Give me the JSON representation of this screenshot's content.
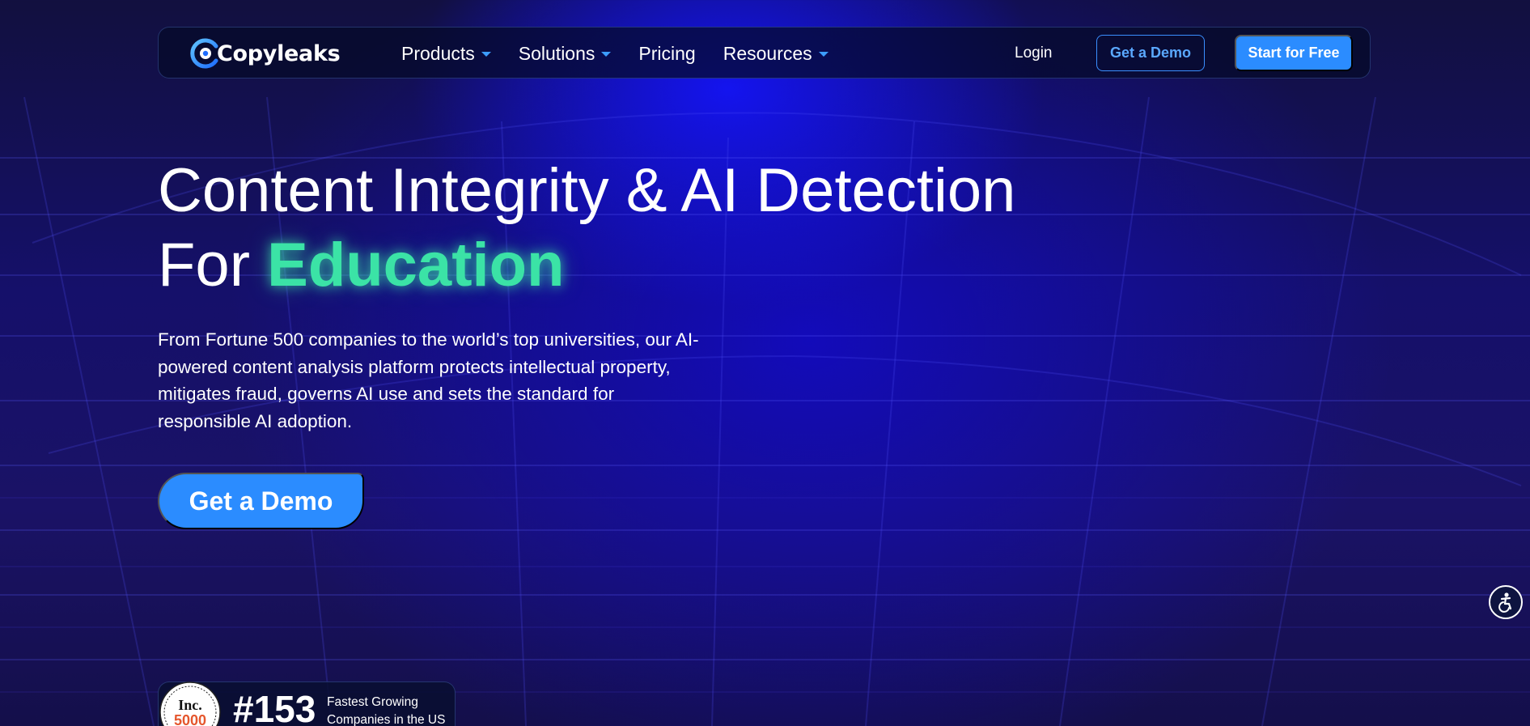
{
  "brand": {
    "name": "Copyleaks",
    "logo_icon": "copyleaks-logo-icon",
    "primary_color": "#2b8cff",
    "accent_color": "#3be3a6"
  },
  "nav": {
    "items": [
      {
        "label": "Products",
        "has_dropdown": true
      },
      {
        "label": "Solutions",
        "has_dropdown": true
      },
      {
        "label": "Pricing",
        "has_dropdown": false
      },
      {
        "label": "Resources",
        "has_dropdown": true
      }
    ],
    "login_label": "Login",
    "demo_label": "Get a Demo",
    "start_label": "Start for Free"
  },
  "hero": {
    "title_line1": "Content Integrity & AI Detection",
    "title_line2_prefix": "For ",
    "title_line2_highlight": "Education",
    "subtitle": "From Fortune 500 companies to the world’s top universities, our AI-powered content analysis platform protects intellectual property, mitigates fraud, governs AI use and sets the standard for responsible AI adoption.",
    "cta_label": "Get a Demo"
  },
  "badge": {
    "seal_text_top": "Inc.",
    "seal_text_bottom": "5000",
    "rank": "#153",
    "description": "Fastest Growing Companies in the US"
  },
  "accessibility": {
    "icon": "accessibility-icon"
  }
}
